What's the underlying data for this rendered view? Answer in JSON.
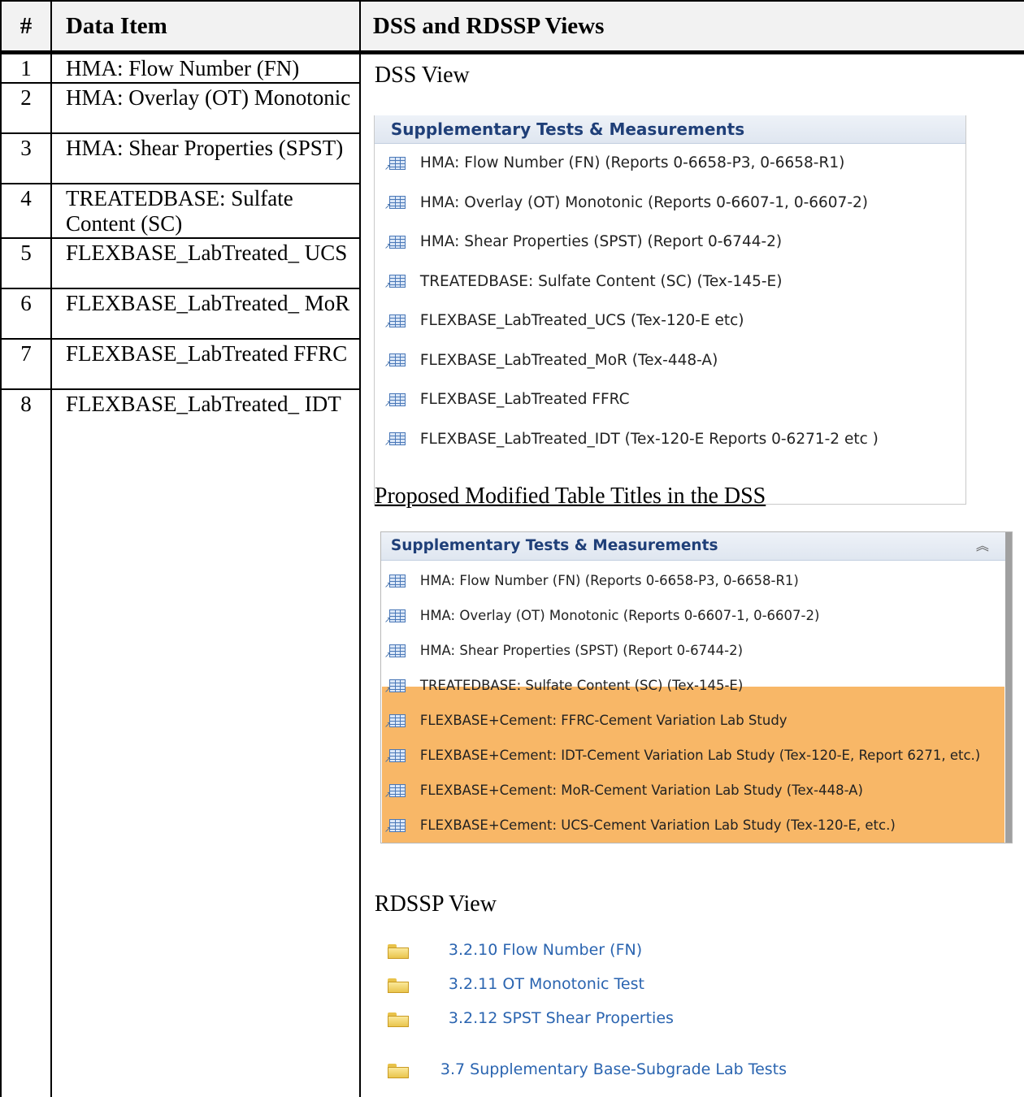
{
  "clipped_title": "upplementary",
  "table": {
    "headers": [
      "#",
      "Data Item",
      "DSS and RDSSP Views"
    ],
    "rows": [
      {
        "num": "1",
        "item": "HMA: Flow Number (FN)"
      },
      {
        "num": "2",
        "item": "HMA: Overlay (OT) Monotonic"
      },
      {
        "num": "3",
        "item": "HMA: Shear Properties (SPST)"
      },
      {
        "num": "4",
        "item": "TREATEDBASE: Sulfate Content (SC)"
      },
      {
        "num": "5",
        "item": "FLEXBASE_LabTreated_ UCS"
      },
      {
        "num": "6",
        "item": "FLEXBASE_LabTreated_ MoR"
      },
      {
        "num": "7",
        "item": "FLEXBASE_LabTreated FFRC"
      },
      {
        "num": "8",
        "item": "FLEXBASE_LabTreated_ IDT"
      }
    ]
  },
  "dss_view": {
    "heading": "DSS View",
    "panel_title": "Supplementary Tests & Measurements",
    "items": [
      "HMA: Flow Number (FN) (Reports 0-6658-P3, 0-6658-R1)",
      "HMA: Overlay (OT) Monotonic (Reports 0-6607-1, 0-6607-2)",
      "HMA: Shear Properties (SPST) (Report 0-6744-2)",
      "TREATEDBASE: Sulfate Content (SC) (Tex-145-E)",
      "FLEXBASE_LabTreated_UCS (Tex-120-E etc)",
      "FLEXBASE_LabTreated_MoR (Tex-448-A)",
      "FLEXBASE_LabTreated FFRC",
      "FLEXBASE_LabTreated_IDT (Tex-120-E Reports 0-6271-2 etc )"
    ]
  },
  "proposed": {
    "heading": "Proposed Modified Table Titles in the DSS",
    "panel_title": "Supplementary Tests & Measurements",
    "collapse_glyph": "«",
    "items": [
      "HMA: Flow Number (FN) (Reports 0-6658-P3, 0-6658-R1)",
      "HMA: Overlay (OT) Monotonic (Reports 0-6607-1, 0-6607-2)",
      "HMA: Shear Properties (SPST) (Report 0-6744-2)",
      "TREATEDBASE: Sulfate Content (SC) (Tex-145-E)",
      "FLEXBASE+Cement: FFRC-Cement Variation Lab Study",
      "FLEXBASE+Cement: IDT-Cement Variation Lab Study (Tex-120-E, Report 6271, etc.)",
      "FLEXBASE+Cement: MoR-Cement Variation Lab Study (Tex-448-A)",
      "FLEXBASE+Cement: UCS-Cement Variation Lab Study (Tex-120-E, etc.)"
    ],
    "highlight_color": "#f8b767"
  },
  "rdssp_view": {
    "heading": "RDSSP View",
    "items": [
      "3.2.10 Flow Number (FN)",
      "3.2.11 OT Monotonic Test",
      "3.2.12 SPST Shear Properties",
      "3.7 Supplementary Base-Subgrade Lab Tests"
    ],
    "link_color": "#2a64b0"
  }
}
